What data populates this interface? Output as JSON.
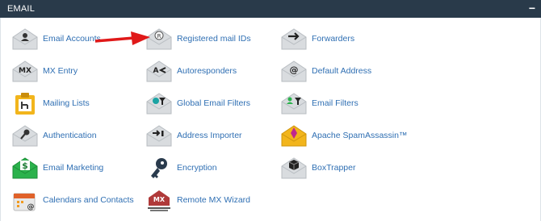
{
  "panel": {
    "title": "EMAIL",
    "collapse_icon": "−"
  },
  "items": [
    {
      "label": "Email Accounts",
      "icon": "envelope-user-icon"
    },
    {
      "label": "Registered mail IDs",
      "icon": "envelope-registered-icon"
    },
    {
      "label": "Forwarders",
      "icon": "envelope-arrow-icon"
    },
    {
      "label": "MX Entry",
      "icon": "envelope-mx-icon"
    },
    {
      "label": "Autoresponders",
      "icon": "envelope-autoresponder-icon"
    },
    {
      "label": "Default Address",
      "icon": "envelope-at-icon"
    },
    {
      "label": "Mailing Lists",
      "icon": "clipboard-list-icon"
    },
    {
      "label": "Global Email Filters",
      "icon": "envelope-filter-icon"
    },
    {
      "label": "Email Filters",
      "icon": "envelope-user-filter-icon"
    },
    {
      "label": "Authentication",
      "icon": "envelope-key-icon"
    },
    {
      "label": "Address Importer",
      "icon": "envelope-import-icon"
    },
    {
      "label": "Apache SpamAssassin™",
      "icon": "envelope-spamassassin-icon"
    },
    {
      "label": "Email Marketing",
      "icon": "envelope-dollar-icon"
    },
    {
      "label": "Encryption",
      "icon": "key-icon"
    },
    {
      "label": "BoxTrapper",
      "icon": "envelope-box-icon"
    },
    {
      "label": "Calendars and Contacts",
      "icon": "calendar-contacts-icon"
    },
    {
      "label": "Remote MX Wizard",
      "icon": "remote-mx-icon"
    }
  ]
}
